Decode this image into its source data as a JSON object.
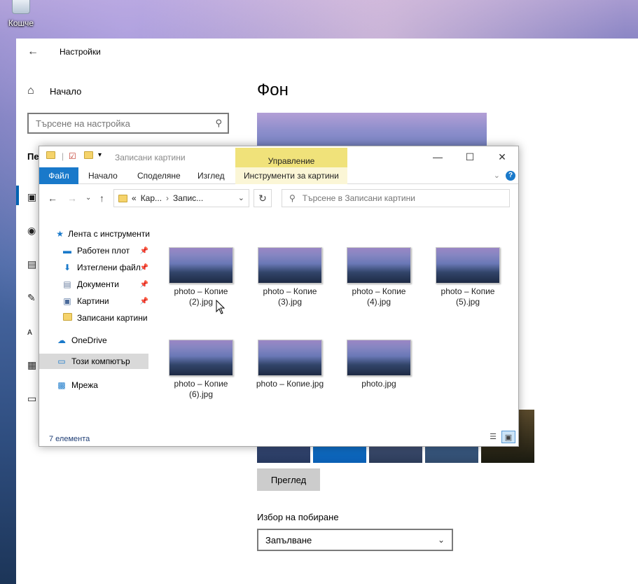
{
  "desktop": {
    "recycle_bin_label": "Кошче"
  },
  "settings": {
    "window_title": "Настройки",
    "home_label": "Начало",
    "search_placeholder": "Търсене на настройка",
    "sidebar_heading": "Пе",
    "page_title": "Фон",
    "browse_button": "Преглед",
    "fit_label": "Избор на побиране",
    "fit_value": "Запълване"
  },
  "explorer": {
    "window_title": "Записани картини",
    "manage_tab": "Управление",
    "ribbon_tabs": [
      "Файл",
      "Начало",
      "Споделяне",
      "Изглед",
      "Инструменти за картини"
    ],
    "address_segments": [
      "Кар...",
      "Запис..."
    ],
    "address_prefix": "«",
    "search_placeholder": "Търсене в Записани картини",
    "nav": {
      "quick_access": "Лента с инструменти",
      "desktop": "Работен плот",
      "downloads": "Изтеглени файл",
      "documents": "Документи",
      "pictures": "Картини",
      "saved_pictures": "Записани картини",
      "onedrive": "OneDrive",
      "this_pc": "Този компютър",
      "network": "Мрежа"
    },
    "files": [
      {
        "name": "photo – Копие (2).jpg"
      },
      {
        "name": "photo – Копие (3).jpg"
      },
      {
        "name": "photo – Копие (4).jpg"
      },
      {
        "name": "photo – Копие (5).jpg"
      },
      {
        "name": "photo – Копие (6).jpg"
      },
      {
        "name": "photo – Копие.jpg"
      },
      {
        "name": "photo.jpg"
      }
    ],
    "status": "7 елемента"
  },
  "colors": {
    "accent": "#1979ca",
    "manage_tab": "#f0e27a",
    "selection": "#d9d9d9"
  },
  "icons": {
    "back": "back-arrow-icon",
    "home": "home-icon",
    "search": "search-icon",
    "folder": "folder-icon",
    "pin": "pin-icon"
  }
}
